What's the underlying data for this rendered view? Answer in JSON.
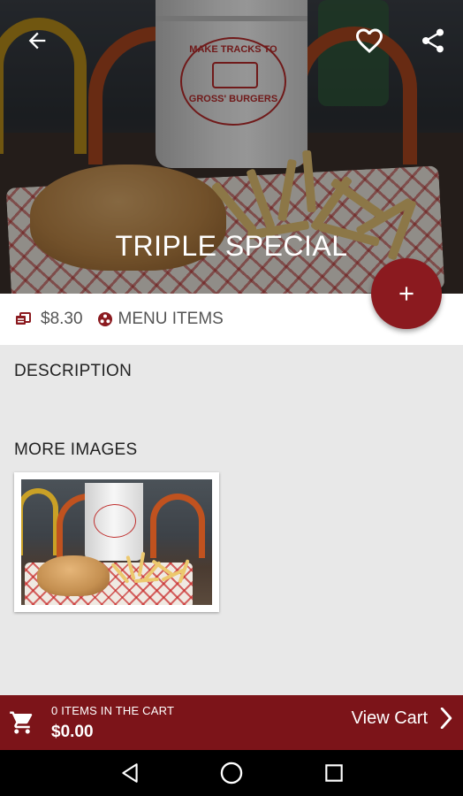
{
  "hero": {
    "title": "TRIPLE SPECIAL",
    "cup_logo_line1": "MAKE TRACKS TO",
    "cup_logo_line2": "GROSS' BURGERS"
  },
  "toolbar": {
    "back_icon": "arrow-back-icon",
    "favorite_icon": "heart-outline-icon",
    "share_icon": "share-icon"
  },
  "fab": {
    "icon": "plus-icon"
  },
  "info": {
    "price": "$8.30",
    "category": "MENU ITEMS"
  },
  "sections": {
    "description_label": "DESCRIPTION",
    "more_images_label": "MORE IMAGES"
  },
  "cart": {
    "items_text": "0 ITEMS IN THE CART",
    "total": "$0.00",
    "view_cart_label": "View Cart"
  },
  "colors": {
    "brand": "#8b1a1f",
    "cart_bar": "#7c1419",
    "page_background": "#e8e8e8"
  }
}
